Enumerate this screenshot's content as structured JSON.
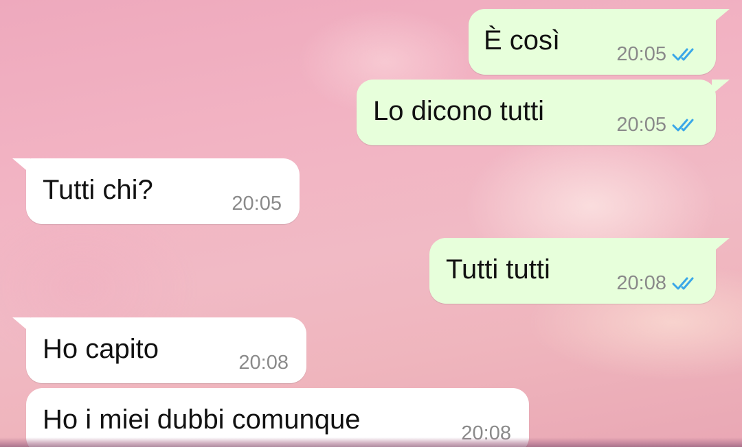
{
  "conversation": {
    "messages": [
      {
        "direction": "out",
        "text": "È così",
        "time": "20:05",
        "status": "read-double-check-icon"
      },
      {
        "direction": "out",
        "text": "Lo dicono tutti",
        "time": "20:05",
        "status": "read-double-check-icon"
      },
      {
        "direction": "in",
        "text": "Tutti chi?",
        "time": "20:05"
      },
      {
        "direction": "out",
        "text": "Tutti tutti",
        "time": "20:08",
        "status": "read-double-check-icon"
      },
      {
        "direction": "in",
        "text": "Ho capito",
        "time": "20:08"
      },
      {
        "direction": "in",
        "text": "Ho i miei dubbi comunque",
        "time": "20:08"
      }
    ]
  },
  "colors": {
    "outgoing_bubble": "#e7ffdb",
    "incoming_bubble": "#ffffff",
    "read_ticks": "#3aa7e8",
    "timestamp": "#8a8a8a"
  }
}
